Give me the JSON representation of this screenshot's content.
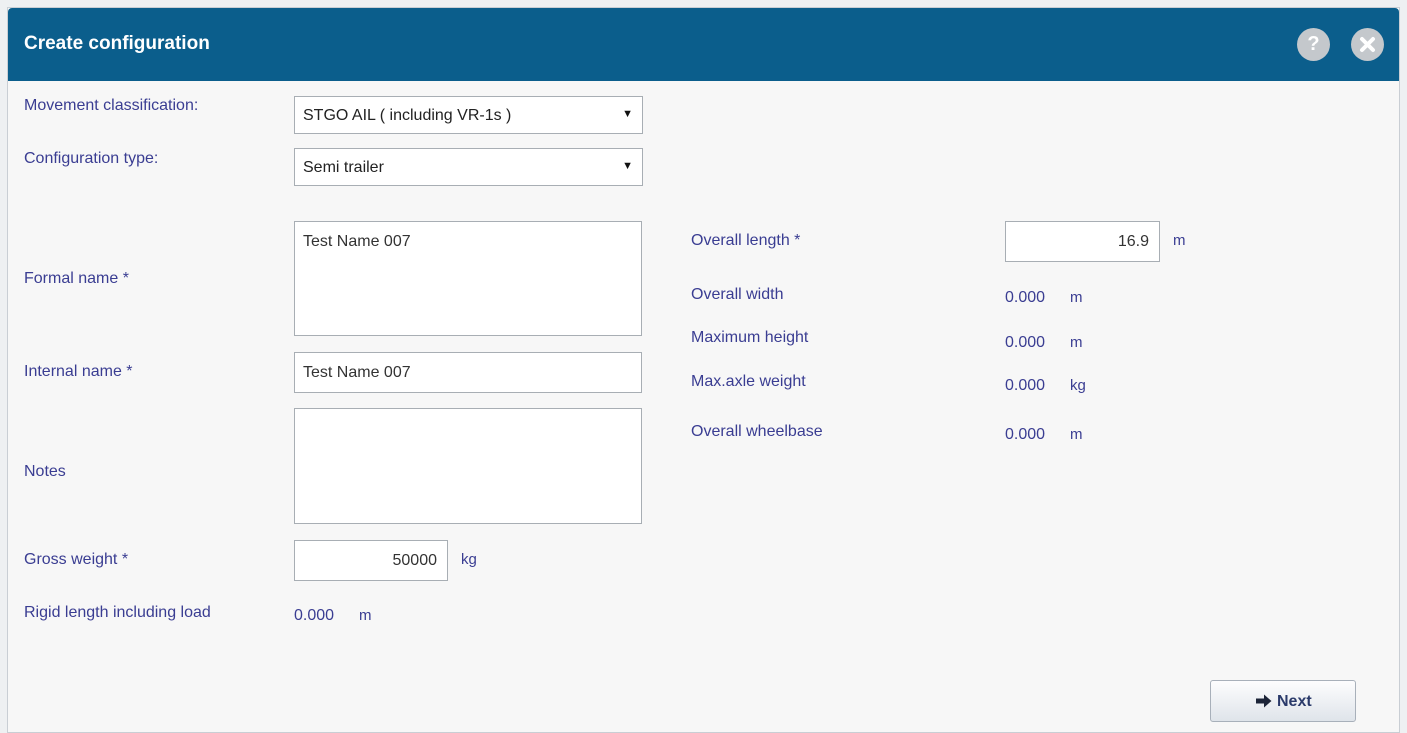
{
  "dialog": {
    "title": "Create configuration",
    "help_icon": "question-icon",
    "close_icon": "close-icon",
    "help_glyph": "?"
  },
  "form": {
    "movement_classification": {
      "label": "Movement classification:",
      "selected": "STGO AIL ( including VR-1s )"
    },
    "configuration_type": {
      "label": "Configuration type:",
      "selected": "Semi trailer"
    },
    "formal_name": {
      "label": "Formal name *",
      "value": "Test Name 007"
    },
    "internal_name": {
      "label": "Internal name *",
      "value": "Test Name 007"
    },
    "notes": {
      "label": "Notes",
      "value": ""
    },
    "gross_weight": {
      "label": "Gross weight *",
      "value": "50000",
      "unit": "kg"
    },
    "rigid_length": {
      "label": "Rigid length including load",
      "value": "0.000",
      "unit": "m"
    }
  },
  "dimensions": {
    "overall_length": {
      "label": "Overall length *",
      "value": "16.9",
      "unit": "m"
    },
    "overall_width": {
      "label": "Overall width",
      "value": "0.000",
      "unit": "m"
    },
    "maximum_height": {
      "label": "Maximum height",
      "value": "0.000",
      "unit": "m"
    },
    "max_axle_weight": {
      "label": "Max.axle weight",
      "value": "0.000",
      "unit": "kg"
    },
    "overall_wheelbase": {
      "label": "Overall wheelbase",
      "value": "0.000",
      "unit": "m"
    }
  },
  "actions": {
    "next_label": "Next",
    "next_icon": "arrow-right-icon"
  },
  "colors": {
    "title_bar": "#0b5e8c",
    "label_text": "#3a3d92"
  }
}
